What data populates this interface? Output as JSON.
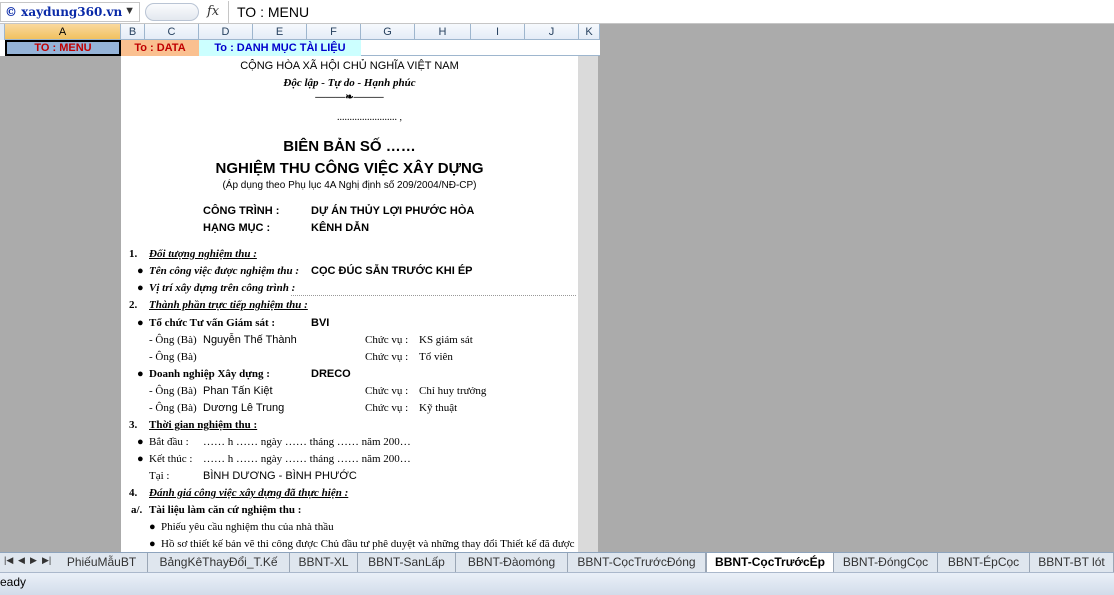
{
  "formula_bar": {
    "name_box": "© xaydung360.vn",
    "fx_label": "fx",
    "formula": "TO : MENU"
  },
  "columns": [
    "A",
    "B",
    "C",
    "D",
    "E",
    "F",
    "G",
    "H",
    "I",
    "J",
    "K"
  ],
  "row1": {
    "a1": "TO : MENU",
    "b1": "To : DATA",
    "d1": "To : DANH MỤC TÀI LIỆU"
  },
  "document": {
    "header1": "CỘNG HÒA XÃ HỘI CHỦ NGHĨA VIỆT NAM",
    "header2": "Độc lập - Tự do - Hạnh phúc",
    "ornament": "———❧———",
    "date_line": "........................ ,",
    "title1": "BIÊN BẢN SỐ ……",
    "title2": "NGHIỆM THU CÔNG VIỆC XÂY DỰNG",
    "subtitle": "(Áp dụng theo Phụ lục 4A Nghị định số 209/2004/NĐ-CP)",
    "project_label": "CÔNG TRÌNH :",
    "project_value": "DỰ ÁN THỦY LỢI PHƯỚC HÒA",
    "item_label": "HẠNG MỤC :",
    "item_value": "KÊNH DẪN",
    "s1_num": "1.",
    "s1_title": "Đối tượng nghiệm thu :",
    "s1_b1_label": "Tên công việc được nghiệm thu :",
    "s1_b1_value": "CỌC ĐÚC SẴN TRƯỚC KHI ÉP",
    "s1_b2_label": "Vị trí xây dựng trên công trình :",
    "s2_num": "2.",
    "s2_title": "Thành phần trực tiếp nghiệm thu :",
    "s2_org1_label": "Tổ chức Tư vấn Giám sát :",
    "s2_org1_value": "BVI",
    "s2_p1_prefix": "- Ông (Bà)",
    "s2_p1_name": "Nguyễn Thế Thành",
    "s2_p1_role_label": "Chức vụ :",
    "s2_p1_role": "KS giám sát",
    "s2_p2_prefix": "- Ông (Bà)",
    "s2_p2_role_label": "Chức vụ :",
    "s2_p2_role": "Tổ viên",
    "s2_org2_label": "Doanh nghiệp Xây dựng :",
    "s2_org2_value": "DRECO",
    "s2_p3_prefix": "- Ông (Bà)",
    "s2_p3_name": "Phan Tấn Kiệt",
    "s2_p3_role_label": "Chức vụ :",
    "s2_p3_role": "Chỉ huy trưởng",
    "s2_p4_prefix": "- Ông (Bà)",
    "s2_p4_name": "Dương Lê Trung",
    "s2_p4_role_label": "Chức vụ :",
    "s2_p4_role": "Kỹ thuật",
    "s3_num": "3.",
    "s3_title": "Thời gian nghiệm thu :",
    "s3_start_label": "Bắt đầu :",
    "s3_start_value": "…… h …… ngày …… tháng …… năm 200…",
    "s3_end_label": "Kết thúc :",
    "s3_end_value": "…… h …… ngày …… tháng …… năm 200…",
    "s3_place_label": "Tại :",
    "s3_place_value": "BÌNH DƯƠNG - BÌNH PHƯỚC",
    "s4_num": "4.",
    "s4_title": "Đánh giá công việc xây dựng đã thực hiện :",
    "s4a_num": "a/.",
    "s4a_title": "Tài liệu làm căn cứ nghiệm thu :",
    "s4a_b1": "Phiếu yêu cầu nghiệm thu của nhà thầu",
    "s4a_b2": "Hồ sơ thiết kế bản vẽ thi công được Chủ đầu tư phê duyệt và những thay đổi Thiết kế đã được"
  },
  "sheet_tabs": [
    "PhiếuMẫuBT",
    "BảngKêThayĐổi_T.Kế",
    "BBNT-XL",
    "BBNT-SanLấp",
    "BBNT-Đàomóng",
    "BBNT-CọcTrướcĐóng",
    "BBNT-CọcTrướcÉp",
    "BBNT-ĐóngCọc",
    "BBNT-ÉpCọc",
    "BBNT-BT lót"
  ],
  "active_tab": "BBNT-CọcTrướcÉp",
  "status_text": "eady"
}
